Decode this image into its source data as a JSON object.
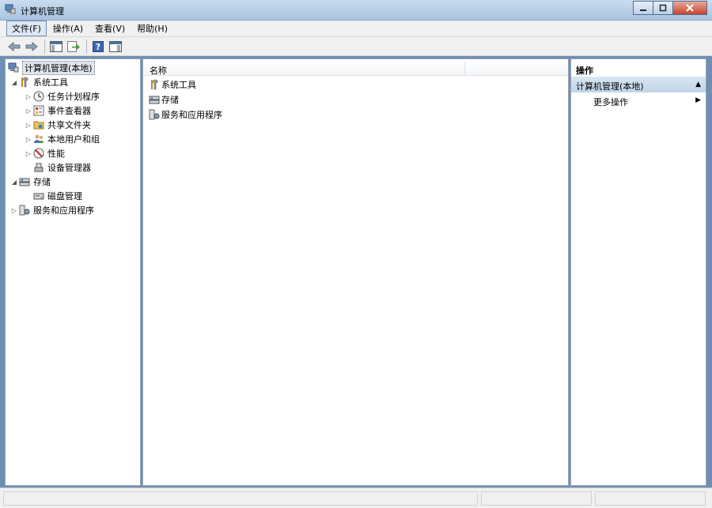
{
  "window": {
    "title": "计算机管理",
    "icon": "computer-management-icon",
    "controls": [
      "minimize",
      "maximize",
      "close"
    ]
  },
  "menu": [
    {
      "label": "文件(F)",
      "active": true
    },
    {
      "label": "操作(A)",
      "active": false
    },
    {
      "label": "查看(V)",
      "active": false
    },
    {
      "label": "帮助(H)",
      "active": false
    }
  ],
  "toolbar": {
    "buttons": [
      "back-arrow-icon",
      "forward-arrow-icon",
      "show-hide-tree-icon",
      "export-list-icon",
      "help-icon",
      "show-hide-action-pane-icon"
    ]
  },
  "tree": {
    "root": "计算机管理(本地)",
    "items": [
      {
        "label": "系统工具",
        "level": 1,
        "expanded": true,
        "icon": "tools-icon"
      },
      {
        "label": "任务计划程序",
        "level": 2,
        "expanded": false,
        "icon": "clock-icon"
      },
      {
        "label": "事件查看器",
        "level": 2,
        "expanded": false,
        "icon": "event-viewer-icon"
      },
      {
        "label": "共享文件夹",
        "level": 2,
        "expanded": false,
        "icon": "shared-folder-icon"
      },
      {
        "label": "本地用户和组",
        "level": 2,
        "expanded": false,
        "icon": "users-icon"
      },
      {
        "label": "性能",
        "level": 2,
        "expanded": false,
        "icon": "performance-icon"
      },
      {
        "label": "设备管理器",
        "level": 2,
        "expanded": null,
        "icon": "device-manager-icon"
      },
      {
        "label": "存储",
        "level": 1,
        "expanded": true,
        "icon": "storage-icon"
      },
      {
        "label": "磁盘管理",
        "level": 2,
        "expanded": null,
        "icon": "disk-icon"
      },
      {
        "label": "服务和应用程序",
        "level": 1,
        "expanded": false,
        "icon": "services-icon"
      }
    ]
  },
  "list": {
    "column": "名称",
    "rows": [
      {
        "label": "系统工具",
        "icon": "tools-icon"
      },
      {
        "label": "存储",
        "icon": "storage-icon"
      },
      {
        "label": "服务和应用程序",
        "icon": "services-icon"
      }
    ]
  },
  "actions": {
    "header": "操作",
    "section": "计算机管理(本地)",
    "item": "更多操作"
  }
}
